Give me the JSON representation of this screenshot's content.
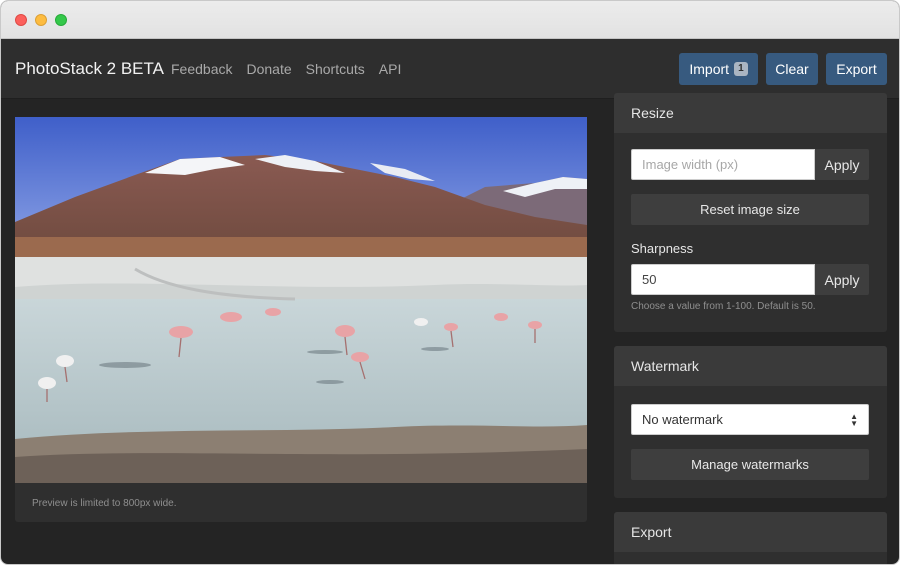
{
  "app": {
    "brand": "PhotoStack 2 BETA",
    "nav": [
      "Feedback",
      "Donate",
      "Shortcuts",
      "API"
    ],
    "buttons": {
      "import": "Import",
      "import_count": "1",
      "clear": "Clear",
      "export": "Export"
    }
  },
  "preview": {
    "note": "Preview is limited to 800px wide."
  },
  "resize": {
    "title": "Resize",
    "width_placeholder": "Image width (px)",
    "apply": "Apply",
    "reset": "Reset image size",
    "sharpness_label": "Sharpness",
    "sharpness_value": "50",
    "sharpness_apply": "Apply",
    "sharpness_help": "Choose a value from 1-100. Default is 50."
  },
  "watermark": {
    "title": "Watermark",
    "selected": "No watermark",
    "manage": "Manage watermarks"
  },
  "export_panel": {
    "title": "Export"
  },
  "colors": {
    "accent": "#375a7f",
    "background": "#242424",
    "panel": "#2f2f2f"
  }
}
